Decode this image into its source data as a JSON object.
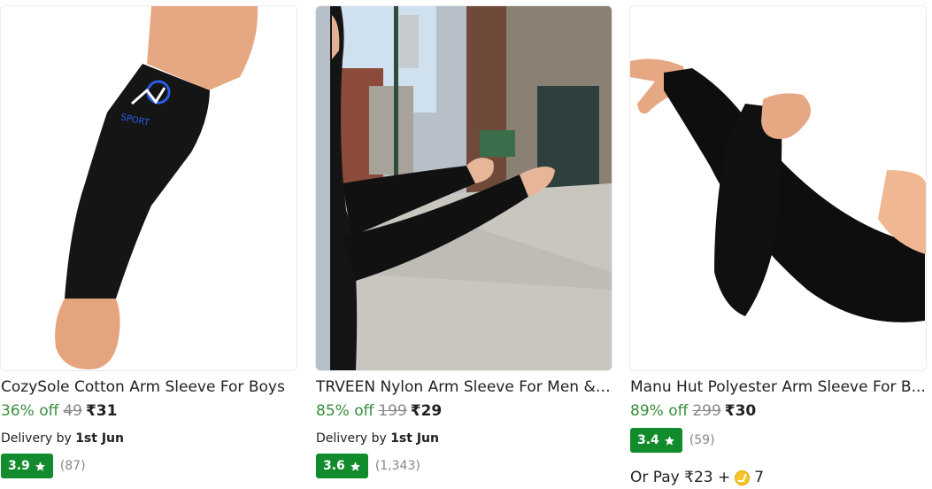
{
  "products": [
    {
      "image_icon": "arm-sleeve-product-image",
      "title": "CozySole Cotton Arm Sleeve For Boys",
      "discount": "36% off",
      "mrp": "49",
      "price": "₹31",
      "delivery_prefix": "Delivery by",
      "delivery_date": "1st Jun",
      "rating": "3.9",
      "rating_count": "(87)"
    },
    {
      "image_icon": "arm-sleeve-street-photo",
      "title": "TRVEEN Nylon Arm Sleeve For Men & ...",
      "discount": "85% off",
      "mrp": "199",
      "price": "₹29",
      "delivery_prefix": "Delivery by",
      "delivery_date": "1st Jun",
      "rating": "3.6",
      "rating_count": "(1,343)"
    },
    {
      "image_icon": "arm-sleeves-pair-image",
      "title": "Manu Hut Polyester Arm Sleeve For B...",
      "discount": "89% off",
      "mrp": "299",
      "price": "₹30",
      "rating": "3.4",
      "rating_count": "(59)",
      "or_pay_prefix": "Or Pay ₹23 +",
      "coins": "7"
    }
  ],
  "colors": {
    "discount_green": "#388e3c",
    "rating_green": "#128b2c",
    "mrp_grey": "#878787"
  }
}
